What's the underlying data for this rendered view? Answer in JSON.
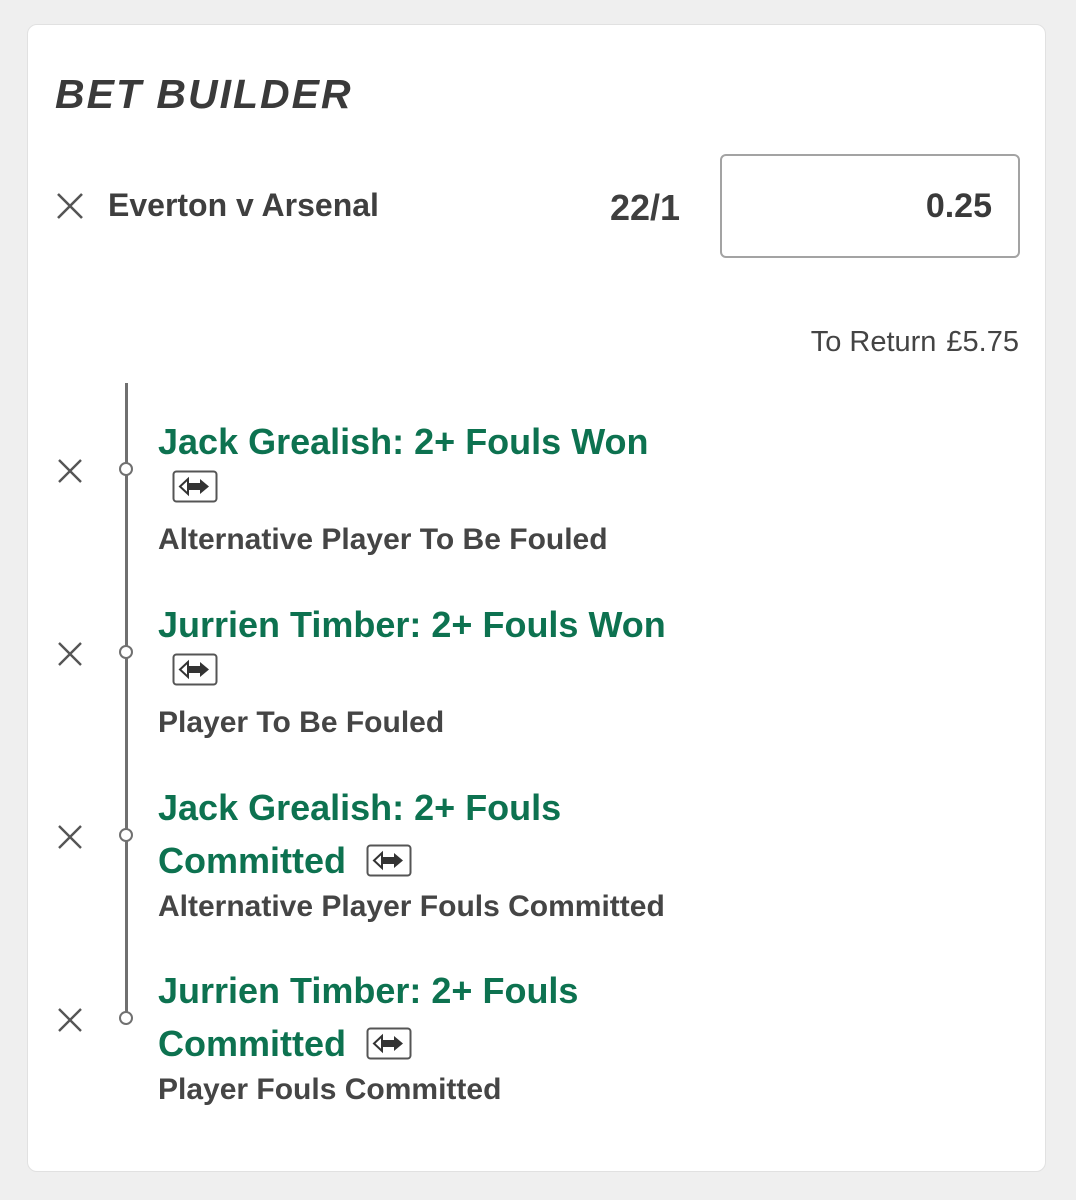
{
  "bet_builder": {
    "title": "BET BUILDER",
    "event": "Everton v Arsenal",
    "odds": "22/1",
    "stake": "0.25",
    "to_return_label": "To Return",
    "to_return_amount": "£5.75",
    "accent_color": "#0d7250",
    "legs": [
      {
        "selection": "Jack Grealish: 2+ Fouls Won",
        "market": "Alternative Player To Be Fouled"
      },
      {
        "selection": "Jurrien Timber: 2+ Fouls Won",
        "market": "Player To Be Fouled"
      },
      {
        "selection_line1": "Jack Grealish: 2+ Fouls",
        "selection_line2": "Committed",
        "market": "Alternative Player Fouls Committed"
      },
      {
        "selection_line1": "Jurrien Timber: 2+ Fouls",
        "selection_line2": "Committed",
        "market": "Player Fouls Committed"
      }
    ],
    "icons": {
      "remove": "close-icon",
      "swap": "swap-icon"
    }
  }
}
